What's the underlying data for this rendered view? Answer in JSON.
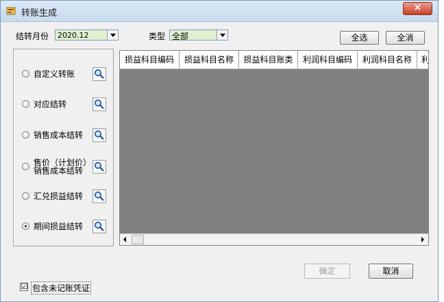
{
  "window": {
    "title": "转账生成",
    "close_symbol": "×"
  },
  "filters": {
    "month_label": "结转月份",
    "month_value": "2020.12",
    "type_label": "类型",
    "type_value": "全部"
  },
  "toolbar": {
    "select_all_label": "全选",
    "deselect_all_label": "全消"
  },
  "options": [
    {
      "label": "自定义转账",
      "checked": false
    },
    {
      "label": "对应结转",
      "checked": false
    },
    {
      "label": "销售成本结转",
      "checked": false
    },
    {
      "label_line1": "售价（计划价）",
      "label_line2": "销售成本结转",
      "checked": false
    },
    {
      "label": "汇兑损益结转",
      "checked": false
    },
    {
      "label": "期间损益结转",
      "checked": true
    }
  ],
  "grid": {
    "columns": [
      "损益科目编码",
      "损益科目名称",
      "损益科目账类",
      "利润科目编码",
      "利润科目名称",
      "利"
    ]
  },
  "footer": {
    "confirm_label": "确定",
    "cancel_label": "取消",
    "include_unposted_label": "包含未记账凭证",
    "include_unposted_mark": "☑"
  },
  "colors": {
    "combo_bg": "#dff0d0",
    "grid_bg": "#808080",
    "close_red": "#c7402a"
  }
}
